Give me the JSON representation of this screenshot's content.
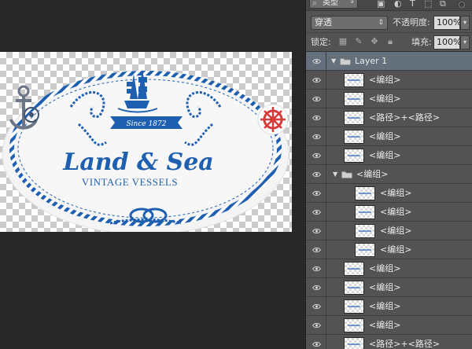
{
  "panel": {
    "filter_kind": "类型",
    "blend_mode": "穿透",
    "opacity_label": "不透明度:",
    "opacity_value": "100%",
    "lock_label": "锁定:",
    "fill_label": "填充:",
    "fill_value": "100%"
  },
  "logo": {
    "since": "Since 1872",
    "title": "Land & Sea",
    "subtitle": "VINTAGE VESSELS"
  },
  "layers": [
    {
      "name": "Layer 1",
      "kind": "group",
      "indent": 0,
      "expanded": true
    },
    {
      "name": "<编组>",
      "kind": "layer",
      "indent": 1
    },
    {
      "name": "<编组>",
      "kind": "layer",
      "indent": 1
    },
    {
      "name": "<路径>+<路径>",
      "kind": "layer",
      "indent": 1
    },
    {
      "name": "<编组>",
      "kind": "layer",
      "indent": 1
    },
    {
      "name": "<编组>",
      "kind": "layer",
      "indent": 1
    },
    {
      "name": "<编组>",
      "kind": "subgroup",
      "indent": 1,
      "expanded": true
    },
    {
      "name": "<编组>",
      "kind": "layer",
      "indent": 2
    },
    {
      "name": "<编组>",
      "kind": "layer",
      "indent": 2
    },
    {
      "name": "<编组>",
      "kind": "layer",
      "indent": 2
    },
    {
      "name": "<编组>",
      "kind": "layer",
      "indent": 2
    },
    {
      "name": "<编组>",
      "kind": "layer",
      "indent": 1
    },
    {
      "name": "<编组>",
      "kind": "layer",
      "indent": 1
    },
    {
      "name": "<编组>",
      "kind": "layer",
      "indent": 1
    },
    {
      "name": "<编组>",
      "kind": "layer",
      "indent": 1
    },
    {
      "name": "<路径>+<路径>",
      "kind": "layer",
      "indent": 1
    }
  ],
  "colors": {
    "logo_blue": "#1f5fb0",
    "wheel_red": "#d63a3a",
    "anchor_gray": "#6a7685"
  }
}
